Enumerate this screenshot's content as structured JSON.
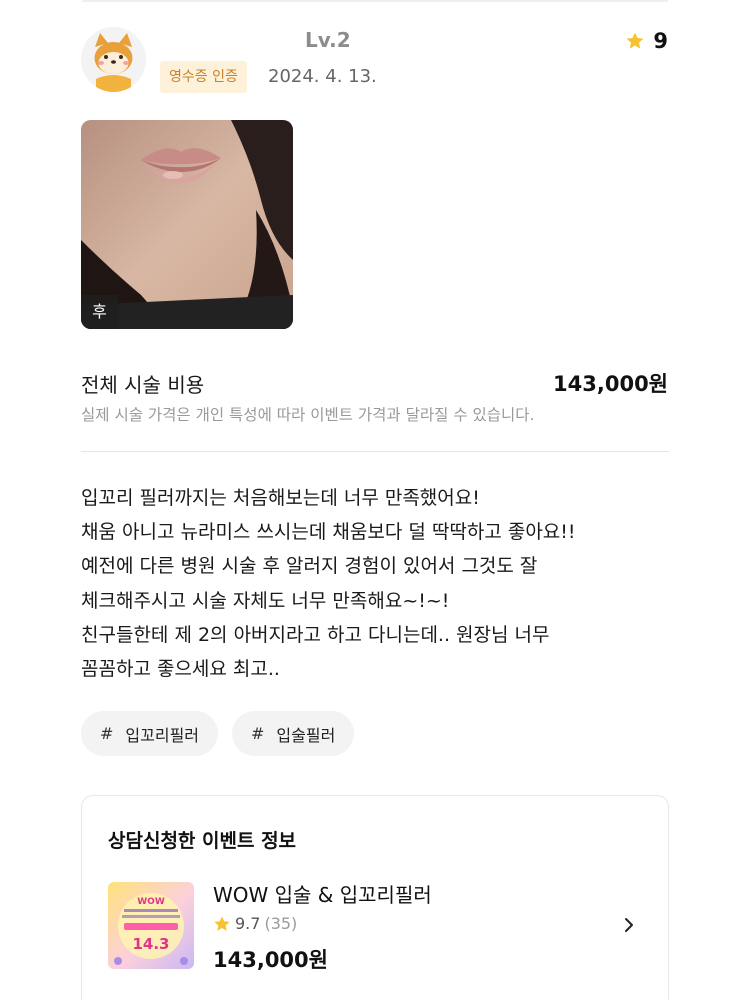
{
  "review": {
    "level": "Lv.2",
    "badge": "영수증 인증",
    "date": "2024. 4. 13.",
    "like_count": "9",
    "photo_tag": "후"
  },
  "cost": {
    "label": "전체 시술 비용",
    "value": "143,000원",
    "note": "실제 시술 가격은 개인 특성에 따라 이벤트 가격과 달라질 수 있습니다."
  },
  "body_lines": [
    "입꼬리 필러까지는 처음해보는데 너무 만족했어요!",
    "채움 아니고 뉴라미스 쓰시는데 채움보다 덜 딱딱하고 좋아요!!",
    "예전에 다른 병원 시술 후 알러지 경험이 있어서 그것도 잘",
    "체크해주시고 시술 자체도 너무 만족해요~!~!",
    "친구들한테 제 2의 아버지라고 하고 다니는데.. 원장님 너무",
    "꼼꼼하고 좋으세요 최고.."
  ],
  "tags": [
    {
      "hash": "#",
      "label": "입꼬리필러"
    },
    {
      "hash": "#",
      "label": "입술필러"
    }
  ],
  "event": {
    "section_title": "상담신청한 이벤트 정보",
    "name": "WOW 입술 & 입꼬리필러",
    "rating": "9.7",
    "rating_count": "(35)",
    "price": "143,000원",
    "thumb_text_top": "WOW",
    "thumb_price": "14.3"
  },
  "colors": {
    "star": "#f7c232",
    "badge_bg": "#fdf1d9",
    "badge_text": "#c9822a"
  }
}
